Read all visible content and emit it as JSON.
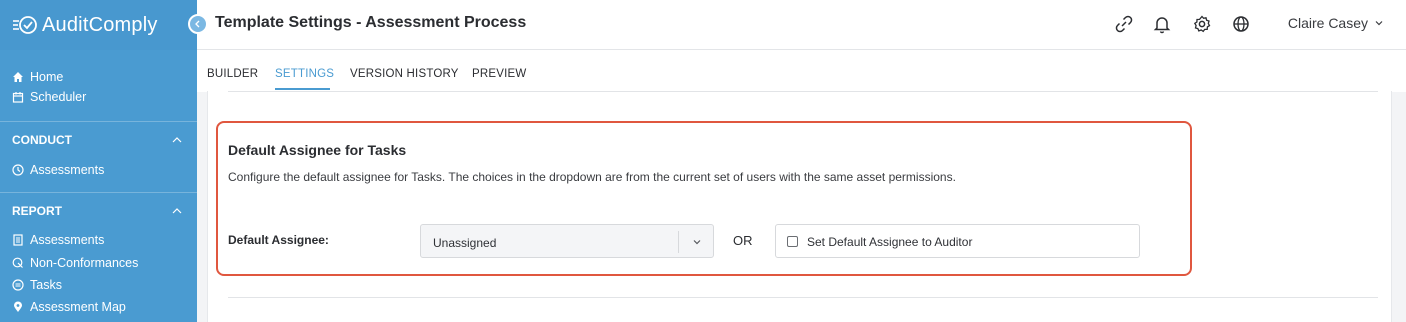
{
  "app": {
    "name": "AuditComply"
  },
  "header": {
    "title": "Template Settings - Assessment Process",
    "icons": [
      "link-icon",
      "bell-icon",
      "gear-icon",
      "globe-icon"
    ],
    "user_name": "Claire Casey"
  },
  "sidebar": {
    "top_items": [
      {
        "label": "Home",
        "icon": "home-icon"
      },
      {
        "label": "Scheduler",
        "icon": "calendar-icon"
      }
    ],
    "sections": [
      {
        "title": "CONDUCT",
        "items": [
          {
            "label": "Assessments",
            "icon": "clock-icon"
          }
        ]
      },
      {
        "title": "REPORT",
        "items": [
          {
            "label": "Assessments",
            "icon": "report-icon"
          },
          {
            "label": "Non-Conformances",
            "icon": "search-icon"
          },
          {
            "label": "Tasks",
            "icon": "list-icon"
          },
          {
            "label": "Assessment Map",
            "icon": "pin-icon"
          }
        ]
      }
    ]
  },
  "tabs": [
    {
      "label": "BUILDER",
      "active": false
    },
    {
      "label": "SETTINGS",
      "active": true
    },
    {
      "label": "VERSION HISTORY",
      "active": false
    },
    {
      "label": "PREVIEW",
      "active": false
    }
  ],
  "settings": {
    "section_title": "Default Assignee for Tasks",
    "description": "Configure the default assignee for Tasks. The choices in the dropdown are from the current set of users with the same asset permissions.",
    "field_label": "Default Assignee:",
    "selected_value": "Unassigned",
    "or_text": "OR",
    "checkbox_label": "Set Default Assignee to Auditor",
    "checkbox_checked": false
  },
  "colors": {
    "sidebar": "#4a9bd1",
    "accent": "#4a9bd1",
    "highlight_border": "#e0573f"
  }
}
